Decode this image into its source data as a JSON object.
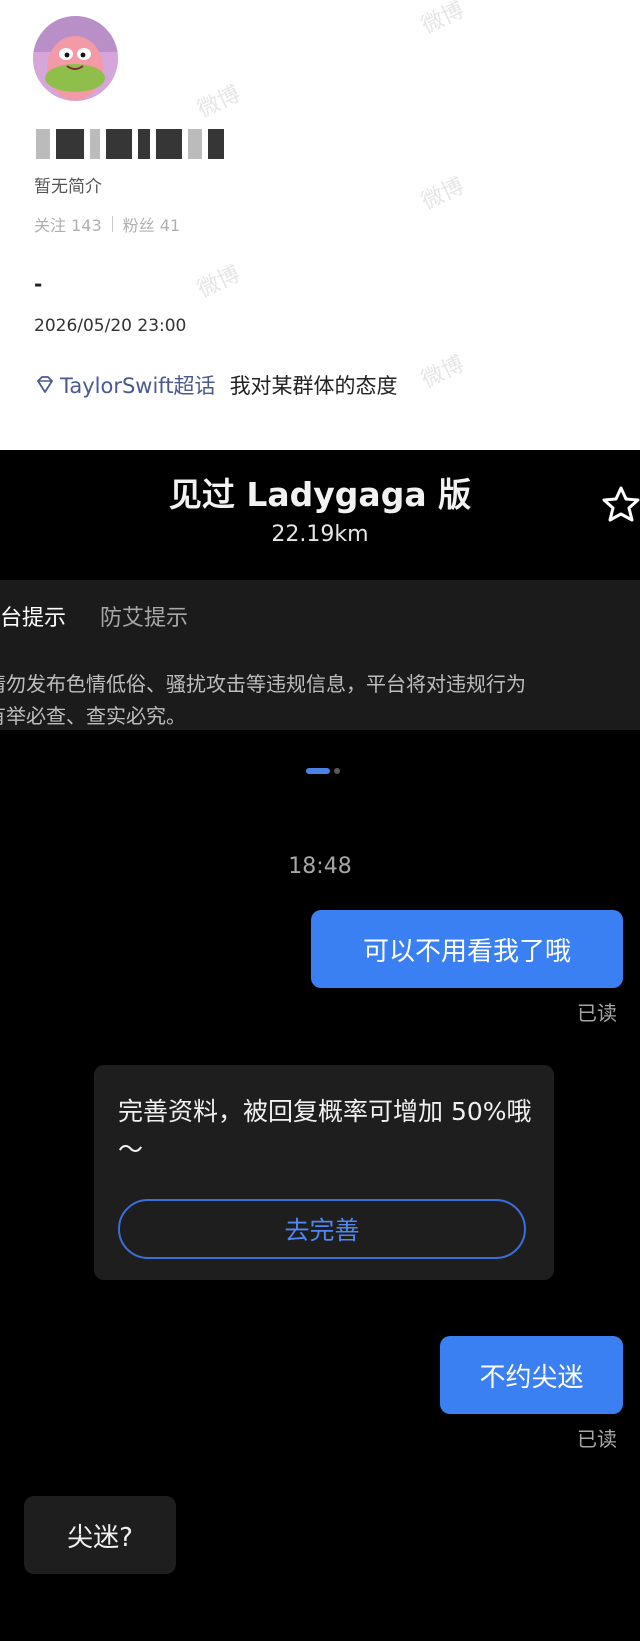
{
  "profile": {
    "bio": "暂无简介",
    "follow_label": "关注",
    "follow_count": "143",
    "fans_label": "粉丝",
    "fans_count": "41",
    "post_text": "-",
    "post_time": "2026/05/20 23:00",
    "topic_link": "TaylorSwift超话",
    "topic_text": "我对某群体的态度",
    "watermark": "微博"
  },
  "chat": {
    "title": "见过 Ladygaga 版",
    "distance": "22.19km",
    "notice": {
      "tab_active": "平台提示",
      "tab_other": "防艾提示",
      "body": "请勿发布色情低俗、骚扰攻击等违规信息，平台将对违规行为\n有举必查、查实必究。"
    },
    "time": "18:48",
    "messages": {
      "me_1": "可以不用看我了哦",
      "read_1": "已读",
      "tip_text": "完善资料，被回复概率可增加 50%哦～",
      "tip_button": "去完善",
      "me_2": "不约尖迷",
      "read_2": "已读",
      "other_1": "尖迷?"
    }
  },
  "colors": {
    "accent_blue": "#3a80f2",
    "topic_link": "#4a5a8c",
    "chat_bg": "#000000",
    "card_bg": "#1e1e1e"
  }
}
